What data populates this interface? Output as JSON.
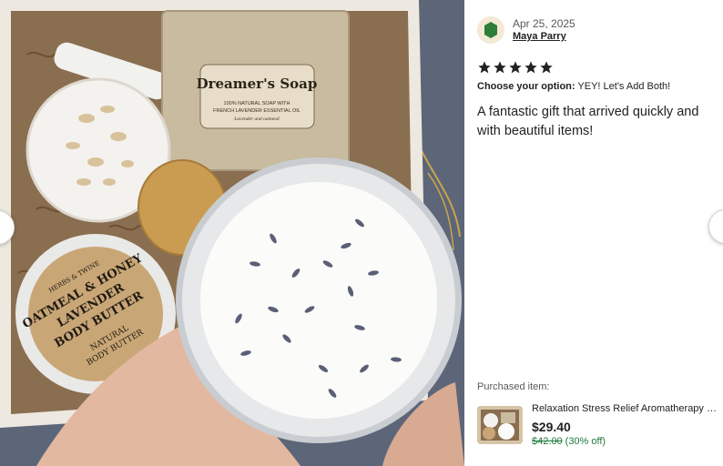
{
  "review": {
    "date": "Apr 25, 2025",
    "reviewer": "Maya Parry",
    "rating": 5,
    "option_label": "Choose your option:",
    "option_value": "YEY! Let's Add Both!",
    "text": "A fantastic gift that arrived quickly and with beautiful items!"
  },
  "purchased": {
    "label": "Purchased item:",
    "title": "Relaxation Stress Relief Aromatherapy Gift Box",
    "price": "$29.40",
    "original_price": "$42.00",
    "discount": "(30% off)"
  },
  "photo": {
    "soap_label": "Dreamer's Soap",
    "soap_line1": "100% NATURAL SOAP WITH",
    "soap_line2": "FRENCH LAVENDER ESSENTIAL OIL",
    "soap_line3": "Lavender and oatmeal",
    "butter_brand": "HERBS & TWINE",
    "butter_line1": "OATMEAL & HONEY",
    "butter_line2": "LAVENDER",
    "butter_line3": "BODY BUTTER",
    "butter_line4": "NATURAL",
    "butter_line5": "BODY BUTTER"
  },
  "colors": {
    "star": "#222222",
    "discount_green": "#1f7a3a",
    "avatar_bg": "#f3e9d5",
    "avatar_leaf": "#2e7d3a"
  },
  "icons": {
    "prev": "chevron-left-icon",
    "next": "chevron-right-icon",
    "star": "star-icon"
  }
}
